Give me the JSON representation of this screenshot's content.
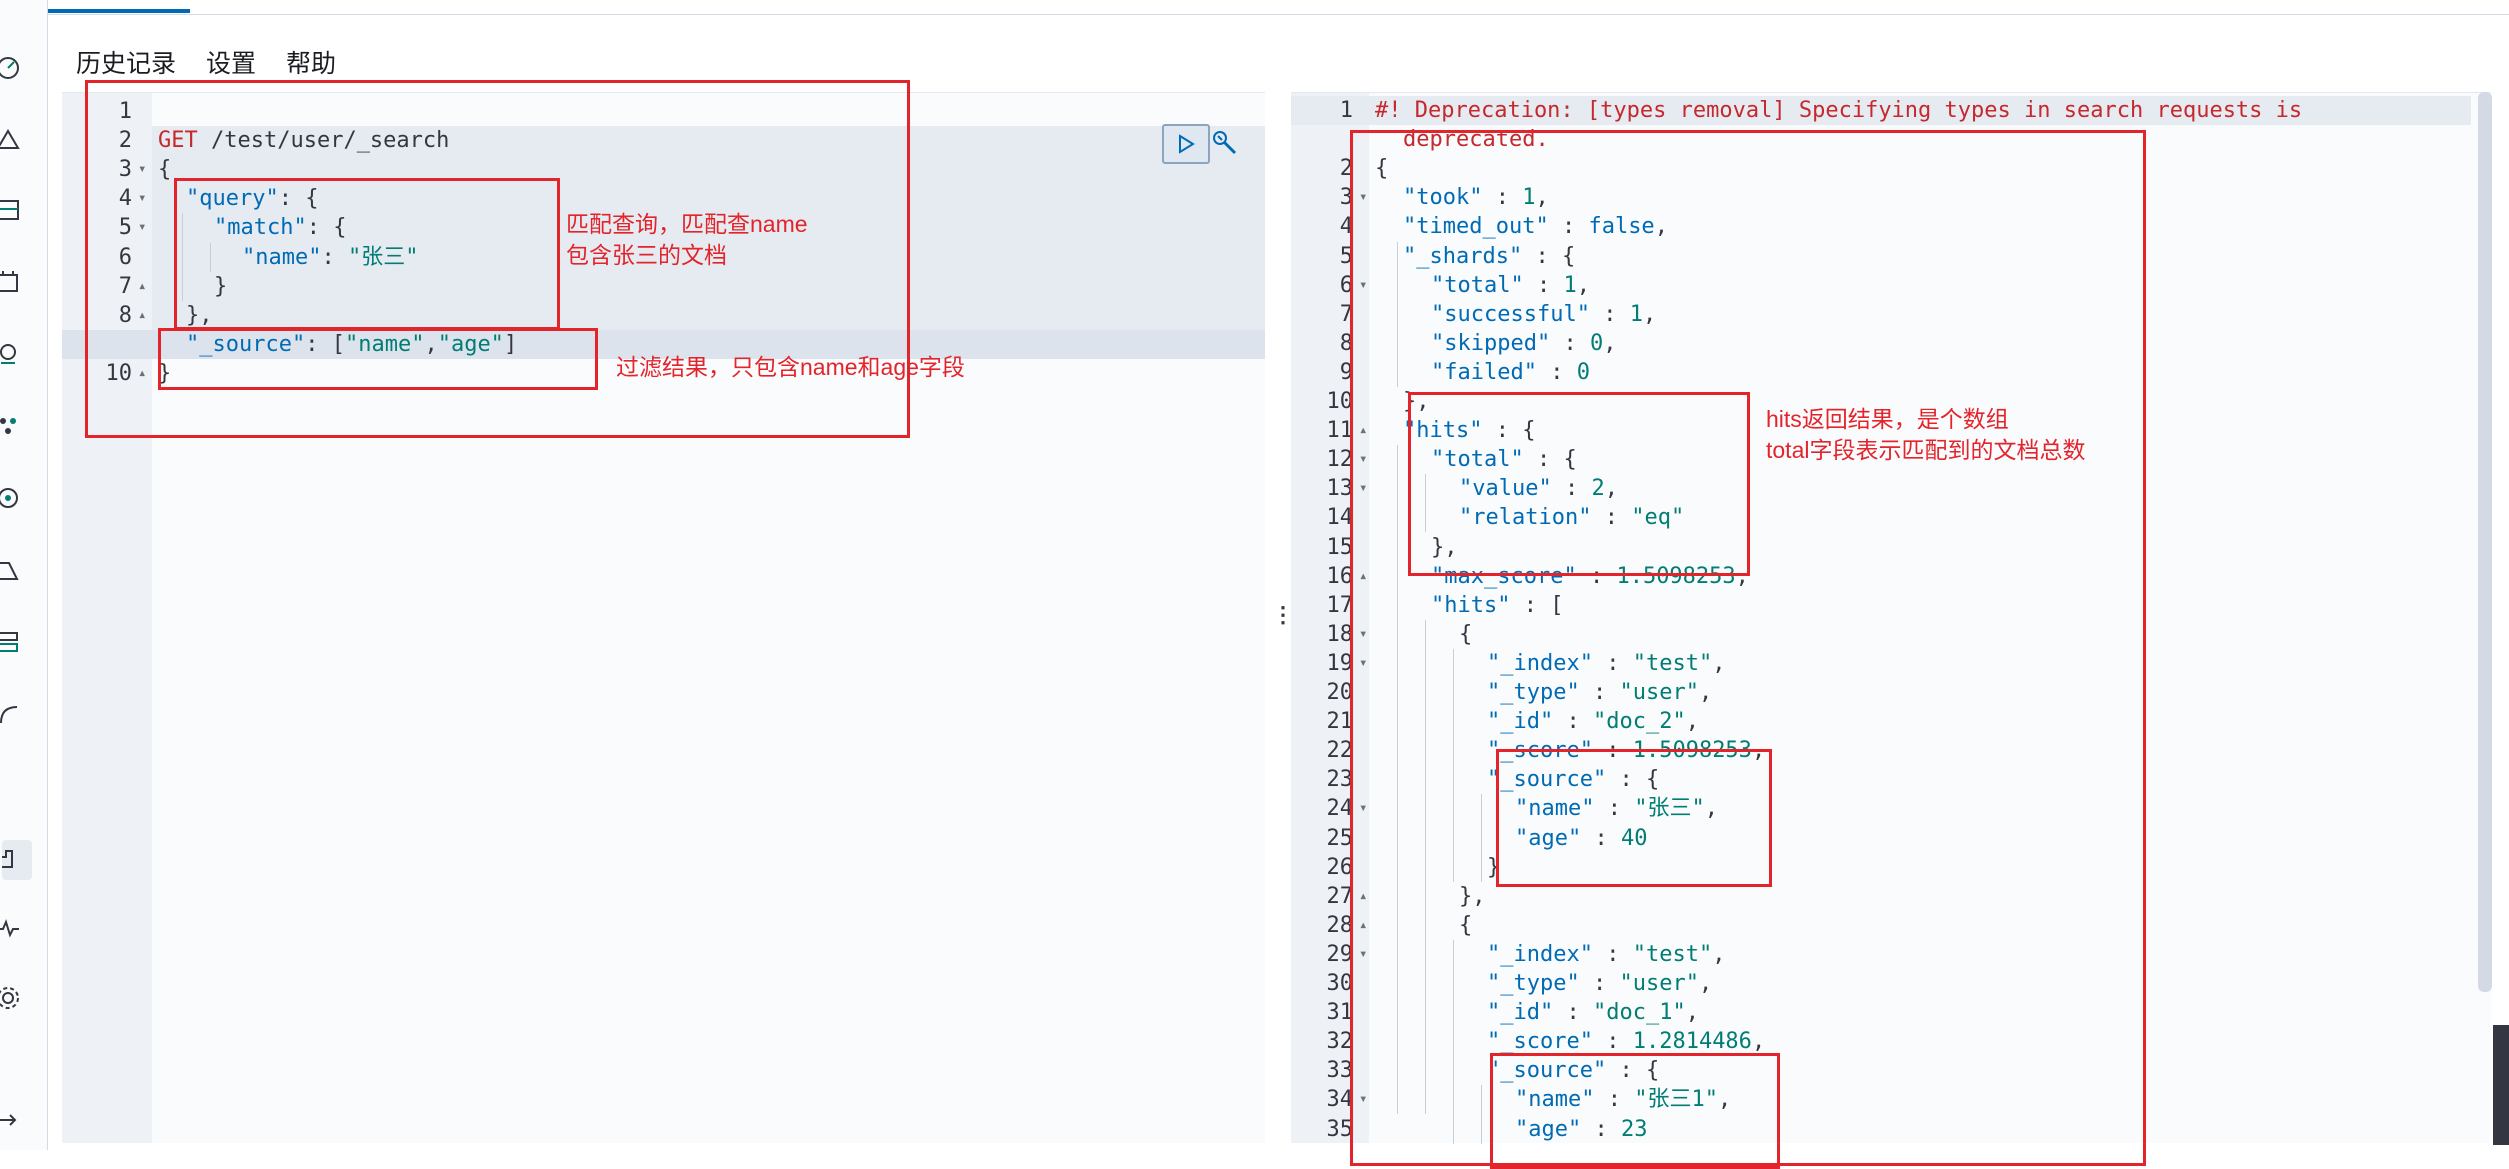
{
  "menu": {
    "history": "历史记录",
    "settings": "设置",
    "help": "帮助"
  },
  "sidebar_icons": [
    "dashboard-icon",
    "discover-icon",
    "visualize-icon",
    "canvas-icon",
    "maps-icon",
    "ml-icon",
    "graph-icon",
    "apm-icon",
    "uptime-icon",
    "siem-icon",
    "devtools-icon",
    "monitoring-icon",
    "management-icon",
    "collapse-icon"
  ],
  "request": {
    "line_numbers": [
      "1",
      "2",
      "3",
      "4",
      "5",
      "6",
      "7",
      "8",
      "9",
      "10"
    ],
    "lines": {
      "l2_method": "GET",
      "l2_path": " /test/user/_search",
      "l3": "{",
      "l4_key": "\"query\"",
      "l4_rest": ": {",
      "l5_key": "\"match\"",
      "l5_rest": ": {",
      "l6_key": "\"name\"",
      "l6_colon": ": ",
      "l6_val": "\"张三\"",
      "l7": "}",
      "l8": "},",
      "l9_key": "\"_source\"",
      "l9_colon": ": [",
      "l9_v1": "\"name\"",
      "l9_comma": ",",
      "l9_v2": "\"age\"",
      "l9_end": "]",
      "l10": "}"
    }
  },
  "response": {
    "line_numbers": [
      "1",
      "2",
      "3",
      "4",
      "5",
      "6",
      "7",
      "8",
      "9",
      "10",
      "11",
      "12",
      "13",
      "14",
      "15",
      "16",
      "17",
      "18",
      "19",
      "20",
      "21",
      "22",
      "23",
      "24",
      "25",
      "26",
      "27",
      "28",
      "29",
      "30",
      "31",
      "32",
      "33",
      "34",
      "35"
    ],
    "warning_1": "#! Deprecation: [types removal] Specifying types in search requests is",
    "warning_2": "deprecated.",
    "lines": [
      [
        "{"
      ],
      [
        "\"took\"",
        " : ",
        "1",
        ","
      ],
      [
        "\"timed_out\"",
        " : ",
        "false",
        ","
      ],
      [
        "\"_shards\"",
        " : {"
      ],
      [
        "\"total\"",
        " : ",
        "1",
        ","
      ],
      [
        "\"successful\"",
        " : ",
        "1",
        ","
      ],
      [
        "\"skipped\"",
        " : ",
        "0",
        ","
      ],
      [
        "\"failed\"",
        " : ",
        "0",
        ""
      ],
      [
        "},"
      ],
      [
        "\"hits\"",
        " : {"
      ],
      [
        "\"total\"",
        " : {"
      ],
      [
        "\"value\"",
        " : ",
        "2",
        ","
      ],
      [
        "\"relation\"",
        " : ",
        "\"eq\"",
        ""
      ],
      [
        "},"
      ],
      [
        "\"max_score\"",
        " : ",
        "1.5098253",
        ","
      ],
      [
        "\"hits\"",
        " : ["
      ],
      [
        "{"
      ],
      [
        "\"_index\"",
        " : ",
        "\"test\"",
        ","
      ],
      [
        "\"_type\"",
        " : ",
        "\"user\"",
        ","
      ],
      [
        "\"_id\"",
        " : ",
        "\"doc_2\"",
        ","
      ],
      [
        "\"_score\"",
        " : ",
        "1.5098253",
        ","
      ],
      [
        "\"_source\"",
        " : {"
      ],
      [
        "\"name\"",
        " : ",
        "\"张三\"",
        ","
      ],
      [
        "\"age\"",
        " : ",
        "40",
        ""
      ],
      [
        "}"
      ],
      [
        "},"
      ],
      [
        "{"
      ],
      [
        "\"_index\"",
        " : ",
        "\"test\"",
        ","
      ],
      [
        "\"_type\"",
        " : ",
        "\"user\"",
        ","
      ],
      [
        "\"_id\"",
        " : ",
        "\"doc_1\"",
        ","
      ],
      [
        "\"_score\"",
        " : ",
        "1.2814486",
        ","
      ],
      [
        "\"_source\"",
        " : {"
      ],
      [
        "\"name\"",
        " : ",
        "\"张三1\"",
        ","
      ],
      [
        "\"age\"",
        " : ",
        "23",
        ""
      ]
    ]
  },
  "annotations": {
    "query_note_1": "匹配查询，匹配查name",
    "query_note_2": "包含张三的文档",
    "source_note": "过滤结果，只包含name和age字段",
    "hits_note_1": "hits返回结果，是个数组",
    "hits_note_2": "total字段表示匹配到的文档总数"
  },
  "colors": {
    "annotation": "#e3242b",
    "keyword": "#006bb4",
    "string": "#017d73",
    "method": "#c5282d"
  }
}
